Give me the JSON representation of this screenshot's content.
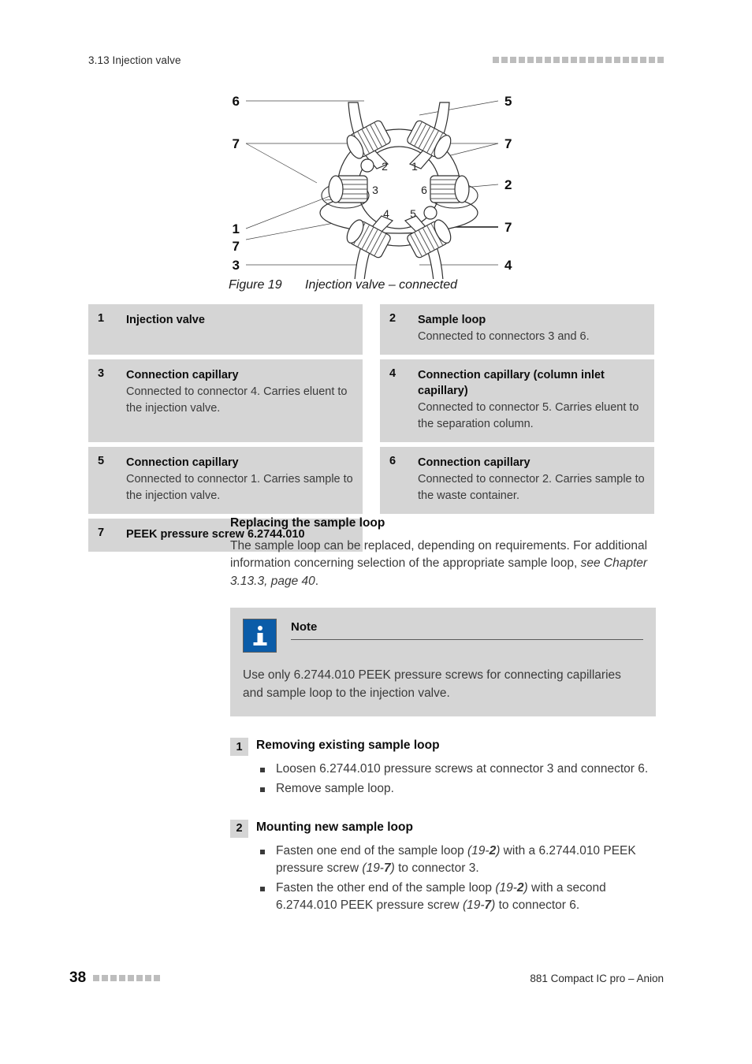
{
  "header": {
    "section": "3.13 Injection valve",
    "marker_squares": 20
  },
  "figure": {
    "caption_number": "Figure 19",
    "caption_text": "Injection valve – connected",
    "left_labels": [
      "6",
      "7",
      "1",
      "7",
      "3"
    ],
    "right_labels": [
      "5",
      "7",
      "2",
      "7",
      "4"
    ],
    "dial_numbers": [
      "2",
      "1",
      "3",
      "6",
      "4",
      "5"
    ]
  },
  "legend": {
    "rows": [
      [
        {
          "num": "1",
          "title": "Injection valve",
          "desc": ""
        },
        {
          "num": "2",
          "title": "Sample loop",
          "desc": "Connected to connectors 3 and 6."
        }
      ],
      [
        {
          "num": "3",
          "title": "Connection capillary",
          "desc": "Connected to connector 4. Carries eluent to the injection valve."
        },
        {
          "num": "4",
          "title": "Connection capillary (column inlet capillary)",
          "desc": "Connected to connector 5. Carries eluent to the separation column."
        }
      ],
      [
        {
          "num": "5",
          "title": "Connection capillary",
          "desc": "Connected to connector 1. Carries sample to the injection valve."
        },
        {
          "num": "6",
          "title": "Connection capillary",
          "desc": "Connected to connector 2. Carries sample to the waste container."
        }
      ],
      [
        {
          "num": "7",
          "title": "PEEK pressure screw 6.2744.010",
          "desc": ""
        }
      ]
    ]
  },
  "content": {
    "section_heading": "Replacing the sample loop",
    "intro_paragraph_part1": "The sample loop can be replaced, depending on requirements. For additional information concerning selection of the appropriate sample loop, ",
    "intro_paragraph_italic": "see Chapter 3.13.3, page 40",
    "intro_paragraph_end": "."
  },
  "note": {
    "title": "Note",
    "body": "Use only 6.2744.010 PEEK pressure screws for connecting capillaries and sample loop to the injection valve.",
    "icon_color": "#0b5ca8"
  },
  "steps": [
    {
      "num": "1",
      "title": "Removing existing sample loop",
      "items": [
        {
          "text": "Loosen 6.2744.010 pressure screws at connector 3 and connector 6."
        },
        {
          "text": "Remove sample loop."
        }
      ]
    },
    {
      "num": "2",
      "title": "Mounting new sample loop",
      "items": [
        {
          "text": "Fasten one end of the sample loop (19-2) with a 6.2744.010 PEEK pressure screw (19-7) to connector 3."
        },
        {
          "text": "Fasten the other end of the sample loop (19-2) with a second 6.2744.010 PEEK pressure screw (19-7) to connector 6."
        }
      ]
    }
  ],
  "footer": {
    "page_number": "38",
    "marker_squares": 8,
    "document_title": "881 Compact IC pro – Anion"
  }
}
